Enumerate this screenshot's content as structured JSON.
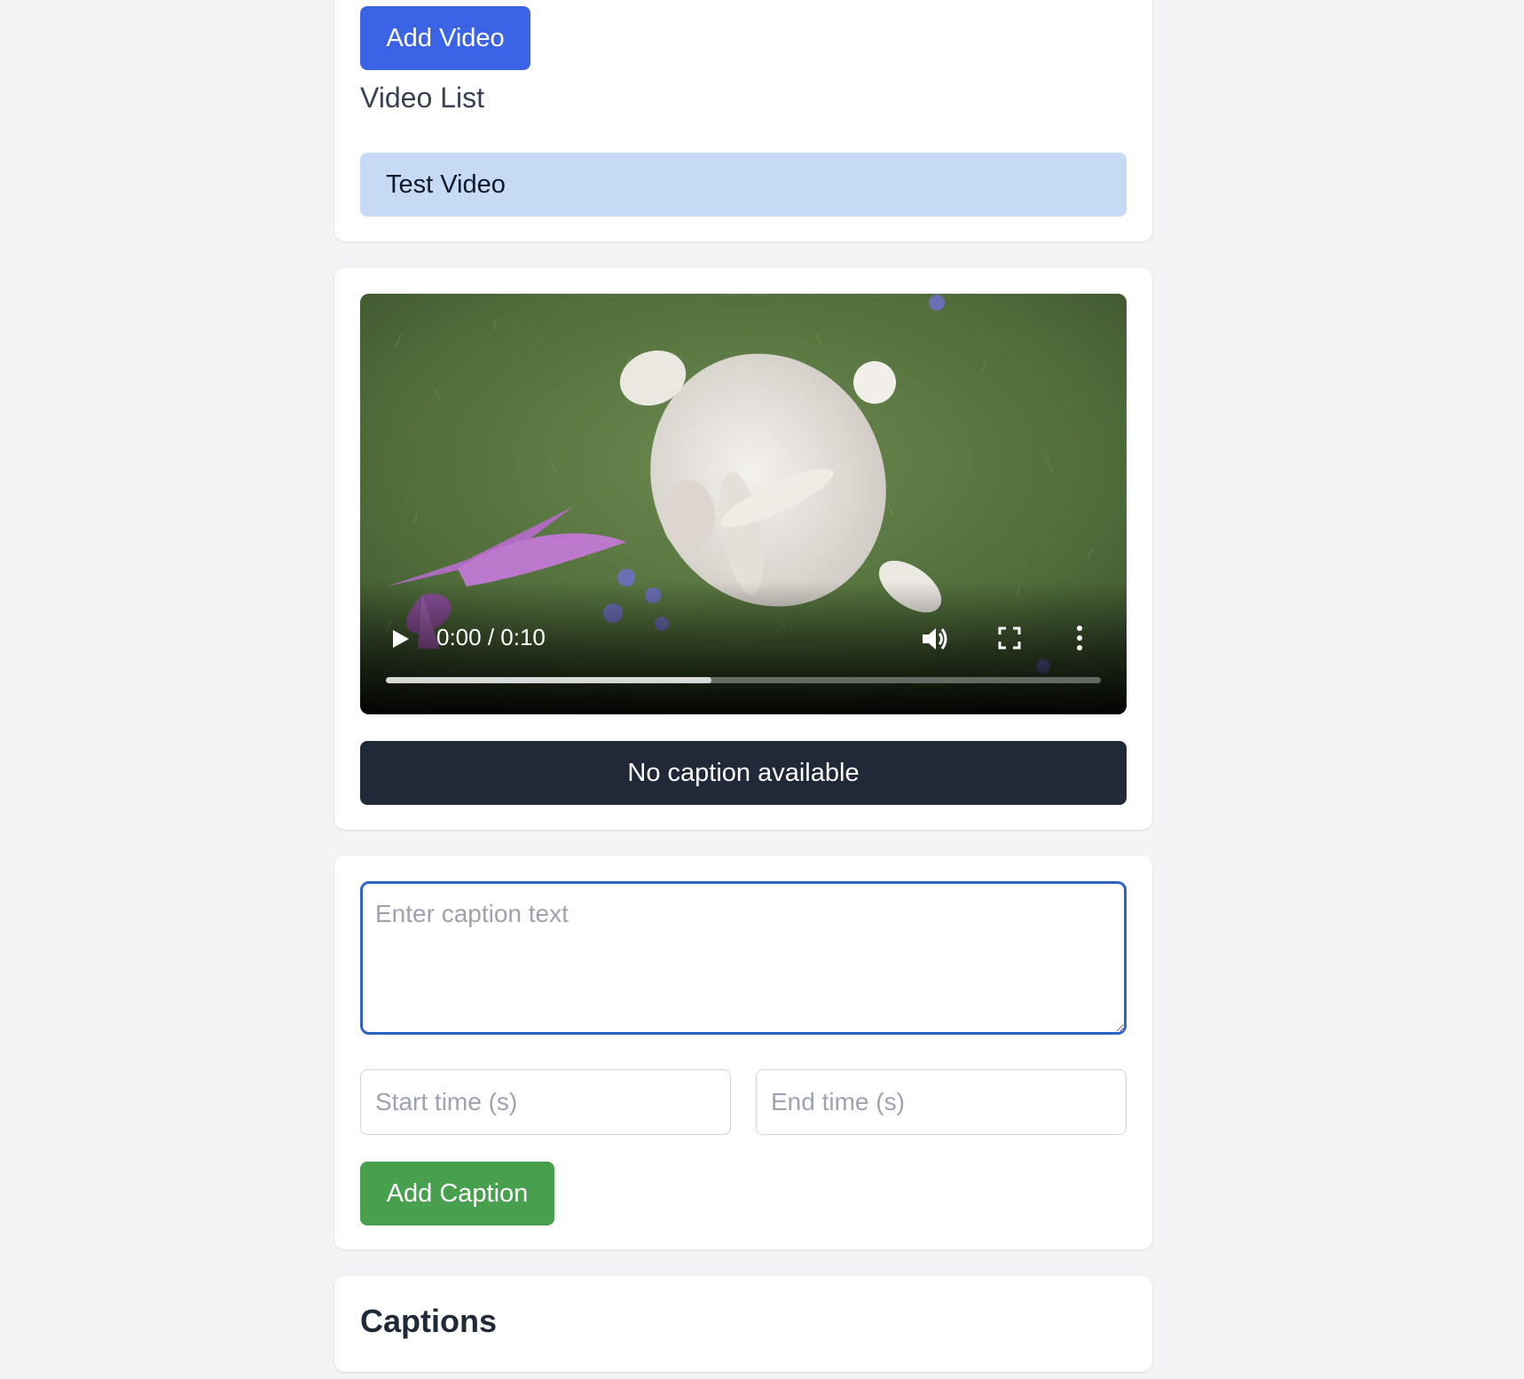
{
  "video_manager": {
    "add_video_label": "Add Video",
    "list_heading": "Video List",
    "videos": [
      {
        "title": "Test Video",
        "selected": true
      }
    ]
  },
  "player": {
    "time_display": "0:00 / 0:10",
    "buffered_fraction": 0.455,
    "played_fraction": 0,
    "controls": [
      "play-icon",
      "volume-icon",
      "fullscreen-icon",
      "more-options-icon"
    ],
    "caption_text": "No caption available"
  },
  "caption_editor": {
    "text_placeholder": "Enter caption text",
    "start_placeholder": "Start time (s)",
    "end_placeholder": "End time (s)",
    "add_caption_label": "Add Caption"
  },
  "captions_section": {
    "heading": "Captions"
  },
  "colors": {
    "primary_button": "#3b63e6",
    "success_button": "#48a04e",
    "selected_item": "#c6daf6",
    "caption_bar": "#1f2937",
    "focus_border": "#3063c8"
  }
}
